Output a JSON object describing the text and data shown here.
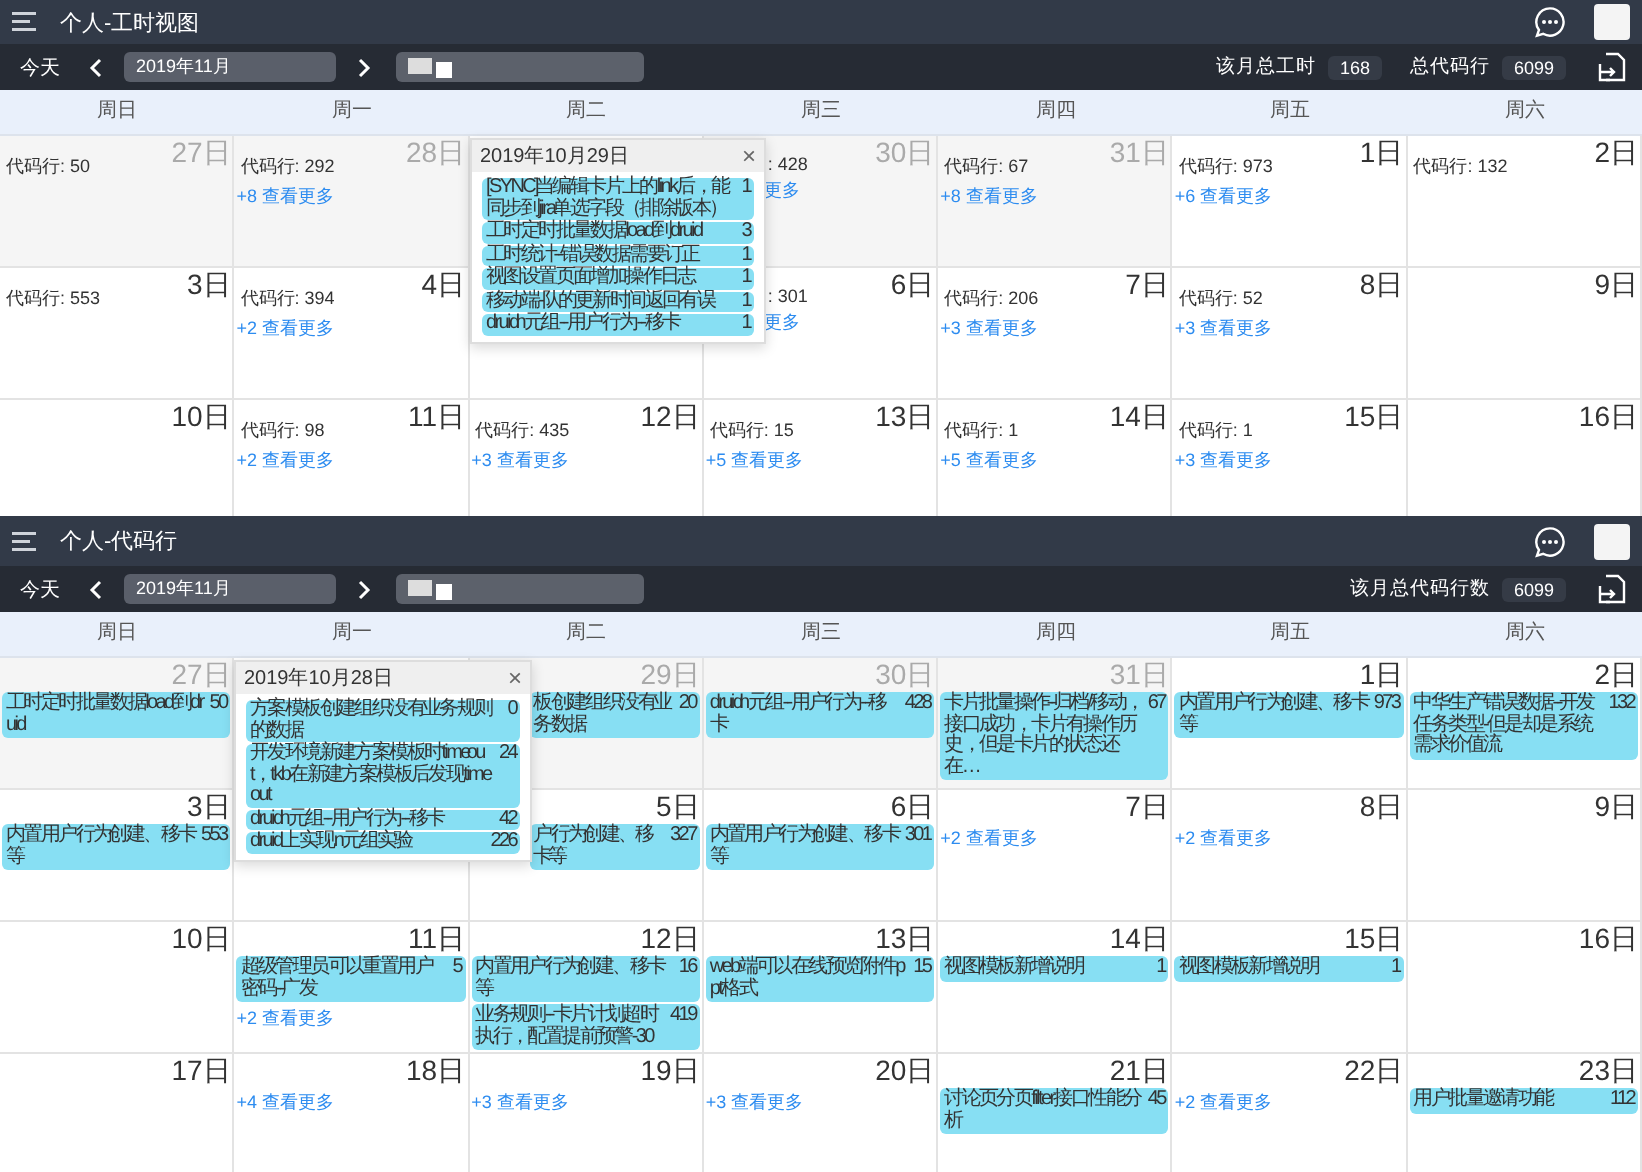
{
  "panels": [
    {
      "title": "个人-工时视图",
      "toolbar": {
        "today": "今天",
        "month": "2019年11月",
        "stats": [
          {
            "label": "该月总工时",
            "value": "168"
          },
          {
            "label": "总代码行",
            "value": "6099"
          }
        ]
      },
      "weekdays": [
        "周日",
        "周一",
        "周二",
        "周三",
        "周四",
        "周五",
        "周六"
      ],
      "weeks": [
        [
          {
            "date": "27日",
            "other_month": true,
            "lines": "代码行: 50"
          },
          {
            "date": "28日",
            "other_month": true,
            "lines": "代码行: 292",
            "more": "+8 查看更多"
          },
          {
            "date": "30日",
            "other_month": true,
            "covered": true,
            "lines": ": 428",
            "more": "更多"
          },
          {
            "date": "31日",
            "other_month": true,
            "lines": "代码行: 67",
            "more": "+8 查看更多"
          },
          {
            "date": "1日",
            "other_month": false,
            "lines": "代码行: 973",
            "more": "+6 查看更多"
          },
          {
            "date": "2日",
            "other_month": false,
            "lines": "代码行: 132"
          }
        ],
        [
          {
            "date": "3日",
            "other_month": false,
            "lines": "代码行: 553"
          },
          {
            "date": "4日",
            "other_month": false,
            "lines": "代码行: 394",
            "more": "+2 查看更多"
          },
          {
            "date": "6日",
            "other_month": false,
            "covered": true,
            "lines": ": 301",
            "more": "更多"
          },
          {
            "date": "7日",
            "other_month": false,
            "lines": "代码行: 206",
            "more": "+3 查看更多"
          },
          {
            "date": "8日",
            "other_month": false,
            "lines": "代码行: 52",
            "more": "+3 查看更多"
          },
          {
            "date": "9日",
            "other_month": false
          }
        ],
        [
          {
            "date": "10日",
            "other_month": false
          },
          {
            "date": "11日",
            "other_month": false,
            "lines": "代码行: 98",
            "more": "+2 查看更多"
          },
          {
            "date": "12日",
            "other_month": false,
            "lines": "代码行: 435",
            "more": "+3 查看更多"
          },
          {
            "date": "13日",
            "other_month": false,
            "lines": "代码行: 15",
            "more": "+5 查看更多"
          },
          {
            "date": "14日",
            "other_month": false,
            "lines": "代码行: 1",
            "more": "+5 查看更多"
          },
          {
            "date": "15日",
            "other_month": false,
            "lines": "代码行: 1",
            "more": "+3 查看更多"
          },
          {
            "date": "16日",
            "other_month": false
          }
        ]
      ],
      "popover": {
        "title": "2019年10月29日",
        "close": "×",
        "events": [
          {
            "title": "[SYNC] 当编辑卡片上的link后，能同步到jira 单选字段（排除版本）",
            "count": "1"
          },
          {
            "title": "工时定时批量数据load到druid",
            "count": "3"
          },
          {
            "title": "工时统计 -- 错误数据需要订正",
            "count": "1"
          },
          {
            "title": "视图设置页面增加操作日志",
            "count": "1"
          },
          {
            "title": "移动端-队 的更新时间返回有误",
            "count": "1"
          },
          {
            "title": "druid n元组--用户行为--移卡",
            "count": "1"
          }
        ]
      }
    },
    {
      "title": "个人-代码行",
      "toolbar": {
        "today": "今天",
        "month": "2019年11月",
        "stats": [
          {
            "label": "该月总代码行数",
            "value": "6099"
          }
        ]
      },
      "weekdays": [
        "周日",
        "周一",
        "周二",
        "周三",
        "周四",
        "周五",
        "周六"
      ],
      "weeks": [
        [
          {
            "date": "27日",
            "other_month": true,
            "events": [
              {
                "title": "工时定时批量数据load到druid",
                "count": "50"
              }
            ]
          },
          {
            "date": "29日",
            "other_month": true,
            "covered": true,
            "events": [
              {
                "title": "板创建组织没有 业务数据",
                "count": "20"
              }
            ]
          },
          {
            "date": "30日",
            "other_month": true,
            "events": [
              {
                "title": "druid n元组--用户行为--移卡",
                "count": "428"
              }
            ]
          },
          {
            "date": "31日",
            "other_month": true,
            "events": [
              {
                "title": "卡片批量操作 -- 归档/移动，接口成功，卡片有操作历史，但是卡片的状态还在…",
                "count": "67"
              }
            ]
          },
          {
            "date": "1日",
            "other_month": false,
            "events": [
              {
                "title": "内置用户行为 创建、移卡等",
                "count": "973"
              }
            ]
          },
          {
            "date": "2日",
            "other_month": false,
            "events": [
              {
                "title": "中华生产错误数据-- 开发任务类型-但是却是系统需求价值流",
                "count": "132"
              }
            ]
          }
        ],
        [
          {
            "date": "3日",
            "other_month": false,
            "events": [
              {
                "title": "内置用户行为 创建、移卡等",
                "count": "553"
              }
            ]
          },
          {
            "date": "5日",
            "other_month": false,
            "covered": true,
            "events": [
              {
                "title": "户行为 创建、移卡 等",
                "count": "327"
              }
            ]
          },
          {
            "date": "6日",
            "other_month": false,
            "events": [
              {
                "title": "内置用户行为 创建、移卡等",
                "count": "301"
              }
            ]
          },
          {
            "date": "7日",
            "other_month": false,
            "more": "+2 查看更多"
          },
          {
            "date": "8日",
            "other_month": false,
            "more": "+2 查看更多"
          },
          {
            "date": "9日",
            "other_month": false
          }
        ],
        [
          {
            "date": "10日",
            "other_month": false
          },
          {
            "date": "11日",
            "other_month": false,
            "events": [
              {
                "title": "超级管理员可以重置用户密码-- 广发",
                "count": "5"
              }
            ],
            "more": "+2 查看更多"
          },
          {
            "date": "12日",
            "other_month": false,
            "events": [
              {
                "title": "内置用户行为 创建、移卡等",
                "count": "16"
              },
              {
                "title": "业务规则--卡片计划超时执行，配置提前预警-30",
                "count": "419"
              }
            ]
          },
          {
            "date": "13日",
            "other_month": false,
            "events": [
              {
                "title": "web端可以在线预览附件ppt格式",
                "count": "15"
              }
            ]
          },
          {
            "date": "14日",
            "other_month": false,
            "events": [
              {
                "title": "视图模板新增说明",
                "count": "1"
              }
            ]
          },
          {
            "date": "15日",
            "other_month": false,
            "events": [
              {
                "title": "视图模板新增说明",
                "count": "1"
              }
            ]
          },
          {
            "date": "16日",
            "other_month": false
          }
        ],
        [
          {
            "date": "17日",
            "other_month": false
          },
          {
            "date": "18日",
            "other_month": false,
            "more": "+4 查看更多"
          },
          {
            "date": "19日",
            "other_month": false,
            "more": "+3 查看更多"
          },
          {
            "date": "20日",
            "other_month": false,
            "more": "+3 查看更多"
          },
          {
            "date": "21日",
            "other_month": false,
            "events": [
              {
                "title": "讨论页分页filter接口性能分析",
                "count": "45"
              }
            ]
          },
          {
            "date": "22日",
            "other_month": false,
            "more": "+2 查看更多"
          },
          {
            "date": "23日",
            "other_month": false,
            "events": [
              {
                "title": "用户批量邀请功能",
                "count": "112"
              }
            ]
          }
        ]
      ],
      "popover": {
        "title": "2019年10月28日",
        "close": "×",
        "events": [
          {
            "title": "方案模板创建组织没有 业务规则的数据",
            "count": "0"
          },
          {
            "title": "开发环境新建方案模板时time out，tkb在新建方案模板后发现time out",
            "count": "24"
          },
          {
            "title": "druid n元组--用户行为--移卡",
            "count": "42"
          },
          {
            "title": "druid上实现n元组实验",
            "count": "226"
          }
        ]
      }
    }
  ]
}
